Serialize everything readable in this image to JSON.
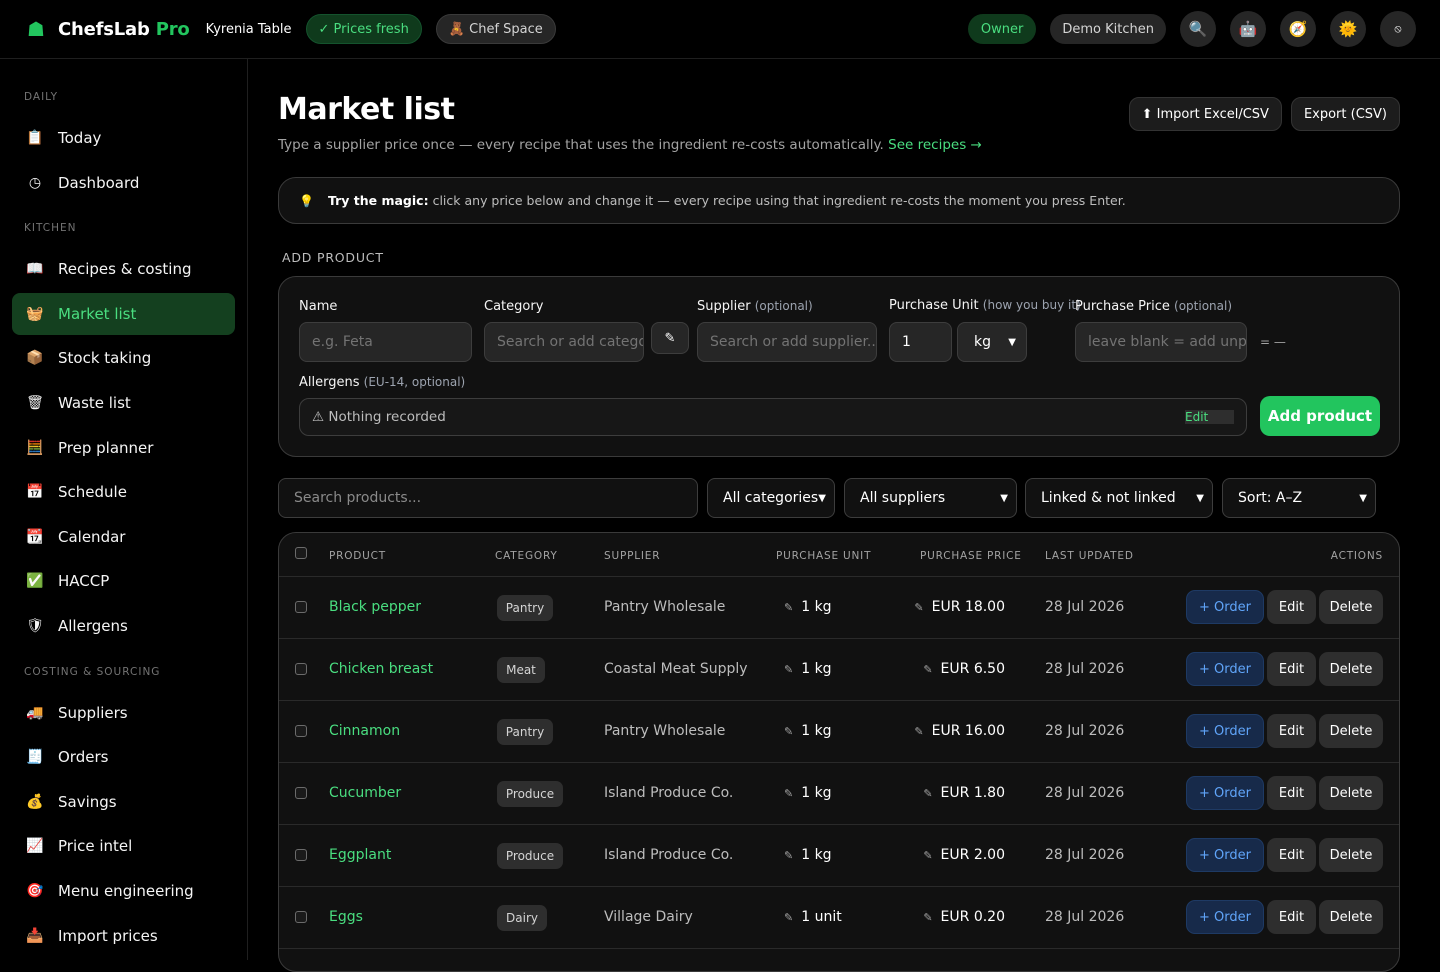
{
  "topbar": {
    "brand": "ChefsLab",
    "brand_pro": "Pro",
    "venue": "Kyrenia Table",
    "prices_badge": "✓ Prices fresh",
    "chef_space": "🧸 Chef Space",
    "role": "Owner",
    "kitchen": "Demo Kitchen"
  },
  "sidebar": {
    "sections": [
      {
        "title": "DAILY",
        "items": [
          {
            "icon": "📋",
            "label": "Today"
          },
          {
            "icon": "◷",
            "label": "Dashboard"
          }
        ]
      },
      {
        "title": "KITCHEN",
        "items": [
          {
            "icon": "📖",
            "label": "Recipes & costing"
          },
          {
            "icon": "🧺",
            "label": "Market list",
            "active": true
          },
          {
            "icon": "📦",
            "label": "Stock taking"
          },
          {
            "icon": "🗑",
            "label": "Waste list"
          },
          {
            "icon": "🧮",
            "label": "Prep planner"
          },
          {
            "icon": "📅",
            "label": "Schedule"
          },
          {
            "icon": "📆",
            "label": "Calendar"
          },
          {
            "icon": "✅",
            "label": "HACCP"
          },
          {
            "icon": "🛡",
            "label": "Allergens"
          }
        ]
      },
      {
        "title": "COSTING & SOURCING",
        "items": [
          {
            "icon": "🚚",
            "label": "Suppliers"
          },
          {
            "icon": "🧾",
            "label": "Orders"
          },
          {
            "icon": "💰",
            "label": "Savings"
          },
          {
            "icon": "📈",
            "label": "Price intel"
          },
          {
            "icon": "🎯",
            "label": "Menu engineering"
          },
          {
            "icon": "📥",
            "label": "Import prices"
          }
        ]
      }
    ]
  },
  "page": {
    "title": "Market list",
    "subtitle": "Type a supplier price once — every recipe that uses the ingredient re-costs automatically.",
    "subtitle_link": "See recipes →",
    "import_btn": "⬆ Import Excel/CSV",
    "export_btn": "Export (CSV)",
    "tip_bold": "Try the magic:",
    "tip_text": "click any price below and change it — every recipe using that ingredient re-costs the moment you press Enter."
  },
  "add_product": {
    "section_label": "ADD PRODUCT",
    "name_label": "Name",
    "name_placeholder": "e.g. Feta",
    "category_label": "Category",
    "category_placeholder": "Search or add category",
    "supplier_label": "Supplier",
    "supplier_opt": "(optional)",
    "supplier_placeholder": "Search or add supplier...",
    "unit_label": "Purchase Unit",
    "unit_hint": "(how you buy it)",
    "unit_qty": "1",
    "unit_value": "kg",
    "price_label": "Purchase Price",
    "price_opt": "(optional)",
    "price_placeholder": "leave blank = add unpriced",
    "price_eq": "= —",
    "allergens_label": "Allergens",
    "allergens_hint": "(EU-14, optional)",
    "allergens_value": "⚠  Nothing recorded",
    "allergens_edit": "Edit",
    "add_button": "Add product"
  },
  "filters": {
    "search_placeholder": "Search products...",
    "category": "All categories",
    "supplier": "All suppliers",
    "link": "Linked & not linked",
    "sort": "Sort: A–Z"
  },
  "table": {
    "columns": [
      "PRODUCT",
      "CATEGORY",
      "SUPPLIER",
      "PURCHASE UNIT",
      "PURCHASE PRICE",
      "LAST UPDATED",
      "ACTIONS"
    ],
    "order_label": "+ Order",
    "edit_label": "Edit",
    "delete_label": "Delete",
    "rows": [
      {
        "product": "Black pepper",
        "category": "Pantry",
        "supplier": "Pantry Wholesale",
        "unit": "1 kg",
        "price": "EUR 18.00",
        "updated": "28 Jul 2026"
      },
      {
        "product": "Chicken breast",
        "category": "Meat",
        "supplier": "Coastal Meat Supply",
        "unit": "1 kg",
        "price": "EUR 6.50",
        "updated": "28 Jul 2026"
      },
      {
        "product": "Cinnamon",
        "category": "Pantry",
        "supplier": "Pantry Wholesale",
        "unit": "1 kg",
        "price": "EUR 16.00",
        "updated": "28 Jul 2026"
      },
      {
        "product": "Cucumber",
        "category": "Produce",
        "supplier": "Island Produce Co.",
        "unit": "1 kg",
        "price": "EUR 1.80",
        "updated": "28 Jul 2026"
      },
      {
        "product": "Eggplant",
        "category": "Produce",
        "supplier": "Island Produce Co.",
        "unit": "1 kg",
        "price": "EUR 2.00",
        "updated": "28 Jul 2026"
      },
      {
        "product": "Eggs",
        "category": "Dairy",
        "supplier": "Village Dairy",
        "unit": "1 unit",
        "price": "EUR 0.20",
        "updated": "28 Jul 2026"
      }
    ]
  }
}
